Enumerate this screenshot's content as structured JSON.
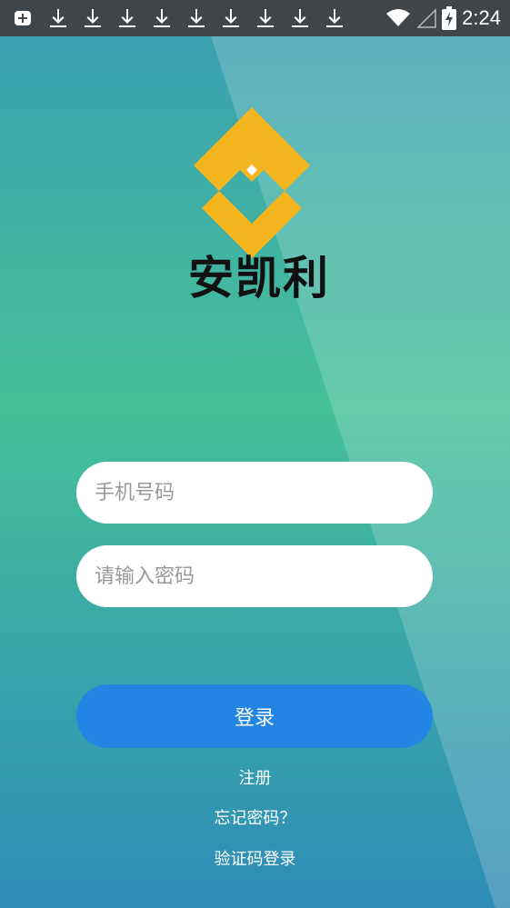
{
  "status_bar": {
    "time": "2:24",
    "icons": [
      "plus-square-icon",
      "download-icon",
      "download-icon",
      "download-icon",
      "download-icon",
      "download-icon",
      "download-icon",
      "download-icon",
      "download-icon",
      "download-icon",
      "wifi-icon",
      "signal-icon",
      "battery-charging-icon"
    ]
  },
  "brand": {
    "name": "安凯利",
    "logo_color": "#f5b51e"
  },
  "form": {
    "phone_placeholder": "手机号码",
    "password_placeholder": "请输入密码"
  },
  "actions": {
    "login_label": "登录",
    "register_label": "注册",
    "forgot_label": "忘记密码？",
    "sms_login_label": "验证码登录"
  },
  "colors": {
    "primary_button": "#2285e3",
    "statusbar_bg": "#3f4548"
  }
}
